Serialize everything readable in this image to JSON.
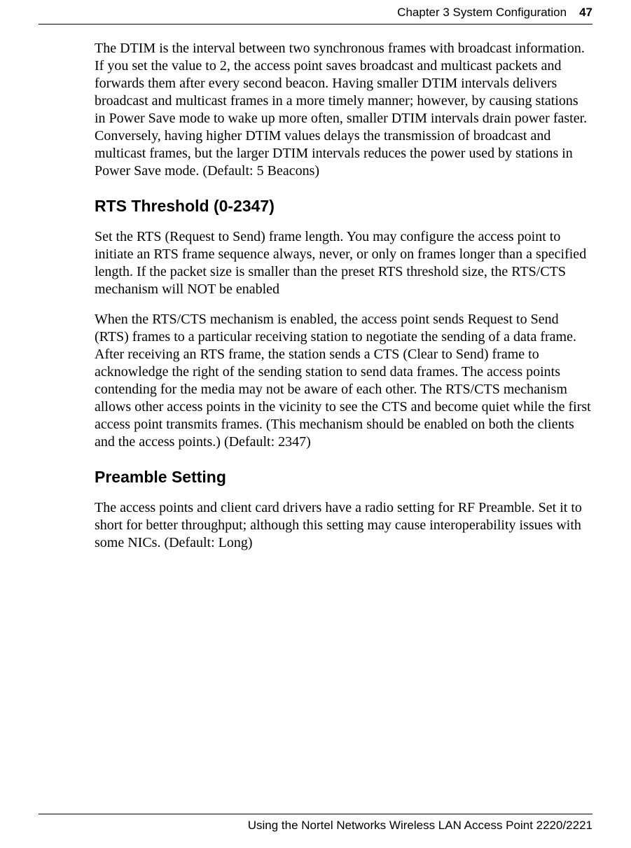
{
  "header": {
    "chapter": "Chapter 3  System Configuration",
    "page_number": "47"
  },
  "body": {
    "para_dtim": "The DTIM is the interval between two synchronous frames with broadcast information. If you set the value to 2, the access point saves broadcast and multicast packets and forwards them after every second beacon. Having smaller DTIM intervals delivers broadcast and multicast frames in a more timely manner; however, by causing stations in Power Save mode to wake up more often, smaller DTIM intervals drain power faster. Conversely, having higher DTIM values delays the transmission of broadcast and multicast frames, but the larger DTIM intervals reduces the power used by stations in Power Save mode. (Default: 5 Beacons)",
    "heading_rts": "RTS Threshold (0-2347)",
    "para_rts_1": "Set the RTS (Request to Send) frame length. You may configure the access point to initiate an RTS frame sequence always, never, or only on frames longer than a specified length. If the packet size is smaller than the preset RTS threshold size, the RTS/CTS mechanism will NOT be enabled",
    "para_rts_2": "When the RTS/CTS mechanism is enabled, the access point sends Request to Send (RTS) frames to a particular receiving station to negotiate the sending of a data frame. After receiving an RTS frame, the station sends a CTS (Clear to Send) frame to acknowledge the right of the sending station to send data frames. The access points contending for the media may not be aware of each other. The RTS/CTS mechanism allows other access points in the vicinity to see the CTS and become quiet while the first access point transmits frames. (This mechanism should be enabled on both the clients and the access points.) (Default: 2347)",
    "heading_preamble": "Preamble Setting",
    "para_preamble": "The access points and client card drivers have a radio setting for RF Preamble. Set it to short for better throughput; although this setting may cause interoperability issues with some NICs. (Default: Long)"
  },
  "footer": {
    "text": "Using the Nortel Networks Wireless LAN Access Point 2220/2221"
  }
}
